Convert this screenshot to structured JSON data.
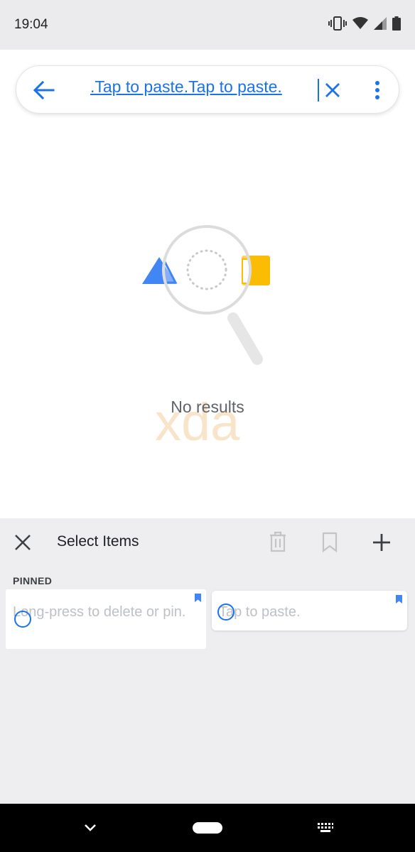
{
  "status_bar": {
    "time": "19:04",
    "icons": [
      "vibrate-icon",
      "wifi-icon",
      "signal-icon",
      "battery-icon"
    ]
  },
  "search": {
    "query": ".Tap to paste.Tap to paste.",
    "icons": [
      "back-arrow-icon",
      "clear-icon",
      "more-vert-icon"
    ]
  },
  "results": {
    "message": "No results",
    "watermark": "xda"
  },
  "clipboard": {
    "title": "Select Items",
    "section_label": "PINNED",
    "items": [
      {
        "text": "Long-press to delete or pin.",
        "pinned": true
      },
      {
        "text": "Tap to paste.",
        "pinned": true
      }
    ],
    "toolbar_icons": [
      "close-icon",
      "delete-icon",
      "bookmark-icon",
      "add-icon"
    ]
  },
  "nav": {
    "icons": [
      "nav-back-icon",
      "nav-home-pill",
      "keyboard-icon"
    ]
  },
  "colors": {
    "accent": "#1a73e8",
    "shape_blue": "#4285f4",
    "shape_yellow": "#fbbc04",
    "panel_bg": "#eeeef0",
    "muted_text": "#bdc1c6",
    "status_bg": "#ebebed"
  }
}
